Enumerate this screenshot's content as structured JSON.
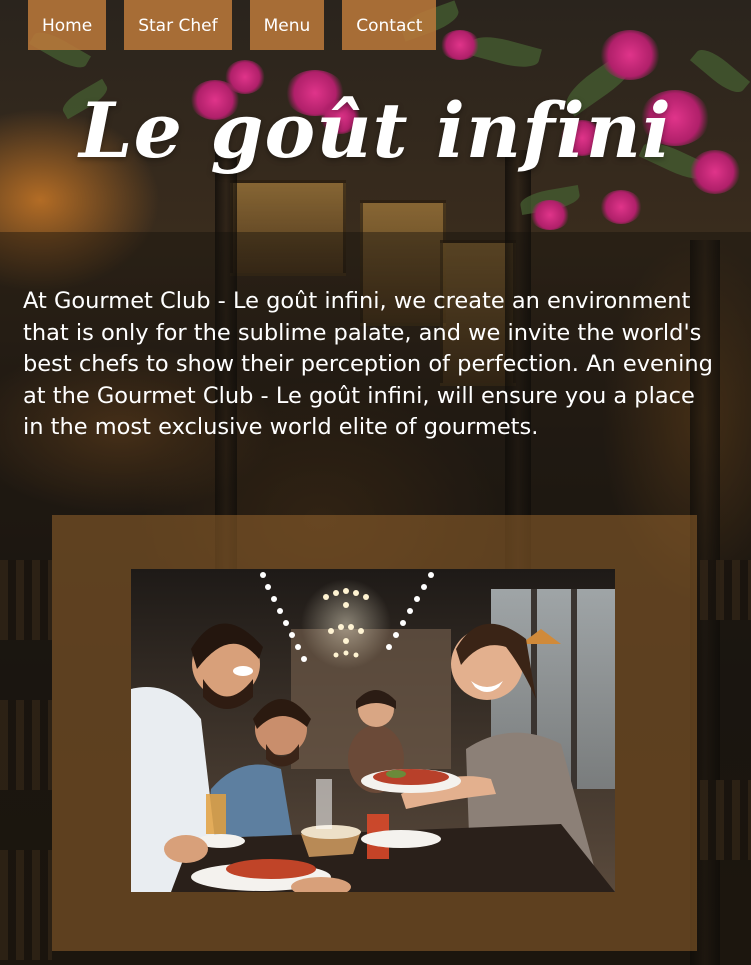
{
  "nav": {
    "items": [
      {
        "label": "Home"
      },
      {
        "label": "Star Chef"
      },
      {
        "label": "Menu"
      },
      {
        "label": "Contact"
      }
    ]
  },
  "header": {
    "title": "Le goût infini"
  },
  "intro": {
    "text": "At Gourmet Club - Le goût infini, we create an environment that is only for the sublime palate, and we invite the world's best chefs to show their perception of perfection. An evening at the Gourmet Club - Le goût infini, will ensure you a place in the most exclusive world elite of gourmets."
  },
  "colors": {
    "nav_background": "#b8783a",
    "card_background": "#96642d",
    "text": "#ffffff"
  },
  "icons": {
    "photo": "diners-photo"
  }
}
